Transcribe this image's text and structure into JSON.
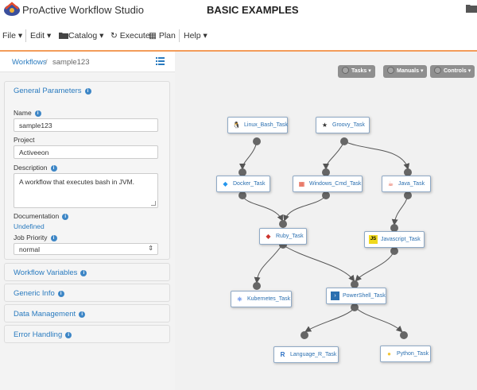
{
  "header": {
    "app_title": "ProActive Workflow Studio",
    "page_heading": "BASIC EXAMPLES"
  },
  "menu": {
    "file": "File ▾",
    "edit": "Edit ▾",
    "catalog": "Catalog ▾",
    "execute": "Execute",
    "plan": "Plan",
    "help": "Help ▾"
  },
  "breadcrumb": {
    "workflows": "Workflows",
    "separator": "/",
    "current": "sample123"
  },
  "general": {
    "title": "General Parameters",
    "name_label": "Name",
    "name_value": "sample123",
    "project_label": "Project",
    "project_value": "Activeeon",
    "description_label": "Description",
    "description_value": "A workflow that executes bash in JVM.",
    "documentation_label": "Documentation",
    "documentation_value": "Undefined",
    "priority_label": "Job Priority",
    "priority_value": "normal"
  },
  "panels": {
    "workflow_variables": "Workflow Variables",
    "generic_info": "Generic Info",
    "data_management": "Data Management",
    "error_handling": "Error Handling"
  },
  "canvas": {
    "tasks_btn": "Tasks ▾",
    "manuals_btn": "Manuals ▾",
    "controls_btn": "Controls ▾",
    "tasks": {
      "linux_bash": "Linux_Bash_Task",
      "groovy": "Groovy_Task",
      "docker": "Docker_Task",
      "windows_cmd": "Windows_Cmd_Task",
      "java": "Java_Task",
      "ruby": "Ruby_Task",
      "javascript": "Javascript_Task",
      "kubernetes": "Kubernetes_Task",
      "powershell": "PowerShell_Task",
      "language_r": "Language_R_Task",
      "python": "Python_Task"
    }
  },
  "colors": {
    "accent": "#f39c5a",
    "link": "#2a7bbf",
    "canvas_bg": "#f1f1f1"
  }
}
